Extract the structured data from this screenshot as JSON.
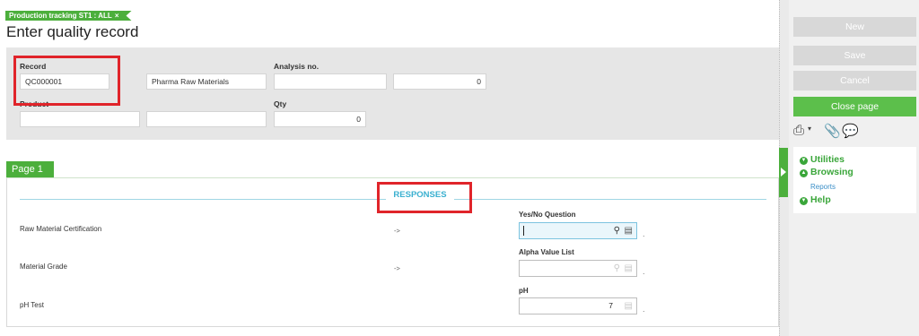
{
  "breadcrumb": {
    "label": "Production tracking ST1 : ALL",
    "close": "×"
  },
  "page_title": "Enter quality record",
  "header": {
    "record_label": "Record",
    "record_value": "QC000001",
    "description_value": "Pharma Raw Materials",
    "analysis_label": "Analysis no.",
    "analysis_value": "",
    "analysis_number": "0",
    "product_label": "Product",
    "product_value": "",
    "product_desc": "",
    "qty_label": "Qty",
    "qty_value": "0"
  },
  "tabs": [
    {
      "label": "Page 1"
    }
  ],
  "responses": {
    "section_title": "RESPONSES",
    "rows": [
      {
        "label": "Raw Material Certification",
        "arrow": "->",
        "question_label": "Yes/No Question",
        "value": "",
        "suffix": "."
      },
      {
        "label": "Material Grade",
        "arrow": "->",
        "question_label": "Alpha Value List",
        "value": "",
        "suffix": "."
      },
      {
        "label": "pH Test",
        "arrow": "",
        "question_label": "pH",
        "value": "7",
        "suffix": "."
      }
    ]
  },
  "sidebar": {
    "new": "New",
    "save": "Save",
    "cancel": "Cancel",
    "close_page": "Close page",
    "utilities": "Utilities",
    "browsing": "Browsing",
    "reports": "Reports",
    "help": "Help"
  },
  "icons": [
    "printer-icon",
    "paperclip-icon",
    "comment-icon",
    "search-icon",
    "list-icon",
    "chevron-icon"
  ],
  "colors": {
    "accent_green": "#4caf3c",
    "section_blue": "#3ab0d0",
    "highlight_red": "#e0242a"
  }
}
